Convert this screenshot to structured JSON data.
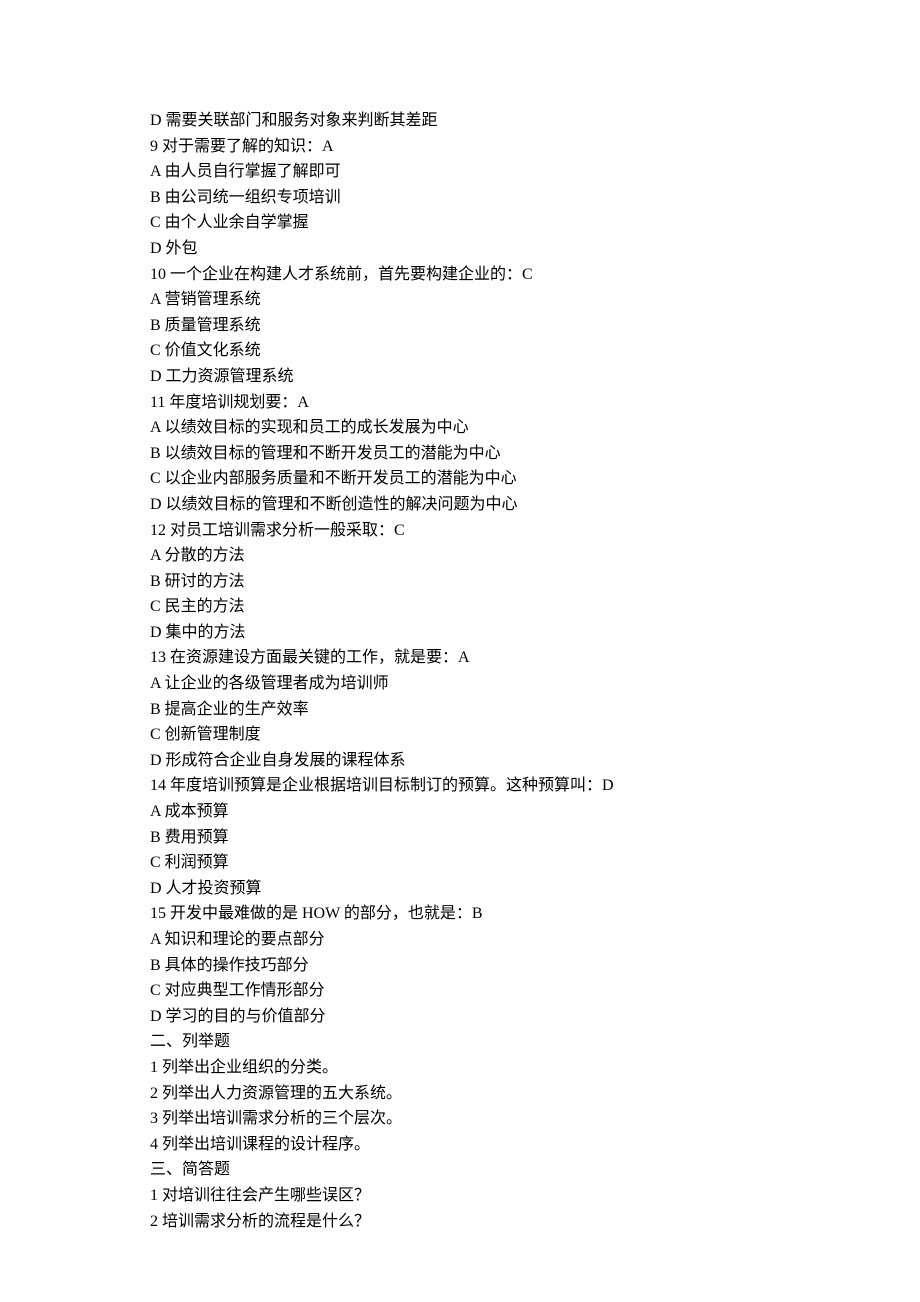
{
  "lines": [
    "D 需要关联部门和服务对象来判断其差距",
    "9 对于需要了解的知识：A",
    "A 由人员自行掌握了解即可",
    "B 由公司统一组织专项培训",
    "C 由个人业余自学掌握",
    "D 外包",
    "10 一个企业在构建人才系统前，首先要构建企业的：C",
    "A 营销管理系统",
    "B 质量管理系统",
    "C 价值文化系统",
    "D 工力资源管理系统",
    "11 年度培训规划要：A",
    "A 以绩效目标的实现和员工的成长发展为中心",
    "B 以绩效目标的管理和不断开发员工的潜能为中心",
    "C 以企业内部服务质量和不断开发员工的潜能为中心",
    "D 以绩效目标的管理和不断创造性的解决问题为中心",
    "12 对员工培训需求分析一般采取：C",
    "A 分散的方法",
    "B 研讨的方法",
    "C 民主的方法",
    "D 集中的方法",
    "13 在资源建设方面最关键的工作，就是要：A",
    "A 让企业的各级管理者成为培训师",
    "B 提高企业的生产效率",
    "C 创新管理制度",
    "D 形成符合企业自身发展的课程体系",
    "14 年度培训预算是企业根据培训目标制订的预算。这种预算叫：D",
    "A 成本预算",
    "B 费用预算",
    "C 利润预算",
    "D 人才投资预算",
    "15 开发中最难做的是 HOW 的部分，也就是：B",
    "A 知识和理论的要点部分",
    "B 具体的操作技巧部分",
    "C 对应典型工作情形部分",
    "D 学习的目的与价值部分",
    "二、列举题",
    "1 列举出企业组织的分类。",
    "2 列举出人力资源管理的五大系统。",
    "3 列举出培训需求分析的三个层次。",
    "4 列举出培训课程的设计程序。",
    "三、简答题",
    "1 对培训往往会产生哪些误区？",
    "2 培训需求分析的流程是什么？"
  ]
}
